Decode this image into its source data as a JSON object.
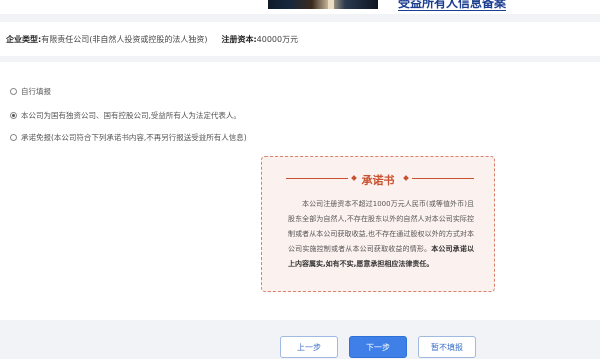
{
  "header": {
    "title": "受益所有人信息备案"
  },
  "info": {
    "type_label": "企业类型:",
    "type_value": "有限责任公司(非自然人投资或控股的法人独资)",
    "capital_label": "注册资本:",
    "capital_value": "40000万元"
  },
  "options": [
    {
      "label": "自行填报",
      "checked": false
    },
    {
      "label": "本公司为国有独资公司、国有控股公司,受益所有人为法定代表人。",
      "checked": true
    },
    {
      "label": "承诺免报(本公司符合下列承诺书内容,不再另行报送受益所有人信息)",
      "checked": false
    }
  ],
  "pledge": {
    "title": "承诺书",
    "body": "本公司注册资本不超过1000万元人民币(或等值外币)且股东全部为自然人,不存在股东以外的自然人对本公司实际控制或者从本公司获取收益,也不存在通过股权以外的方式对本公司实施控制或者从本公司获取收益的情形。",
    "body_bold": "本公司承诺以上内容属实,如有不实,愿意承担相应法律责任。"
  },
  "buttons": {
    "prev": "上一步",
    "next": "下一步",
    "skip": "暂不填报"
  },
  "colors": {
    "accent": "#3f80e8",
    "heading": "#1b3d8f",
    "pledge_red": "#c8522f"
  }
}
